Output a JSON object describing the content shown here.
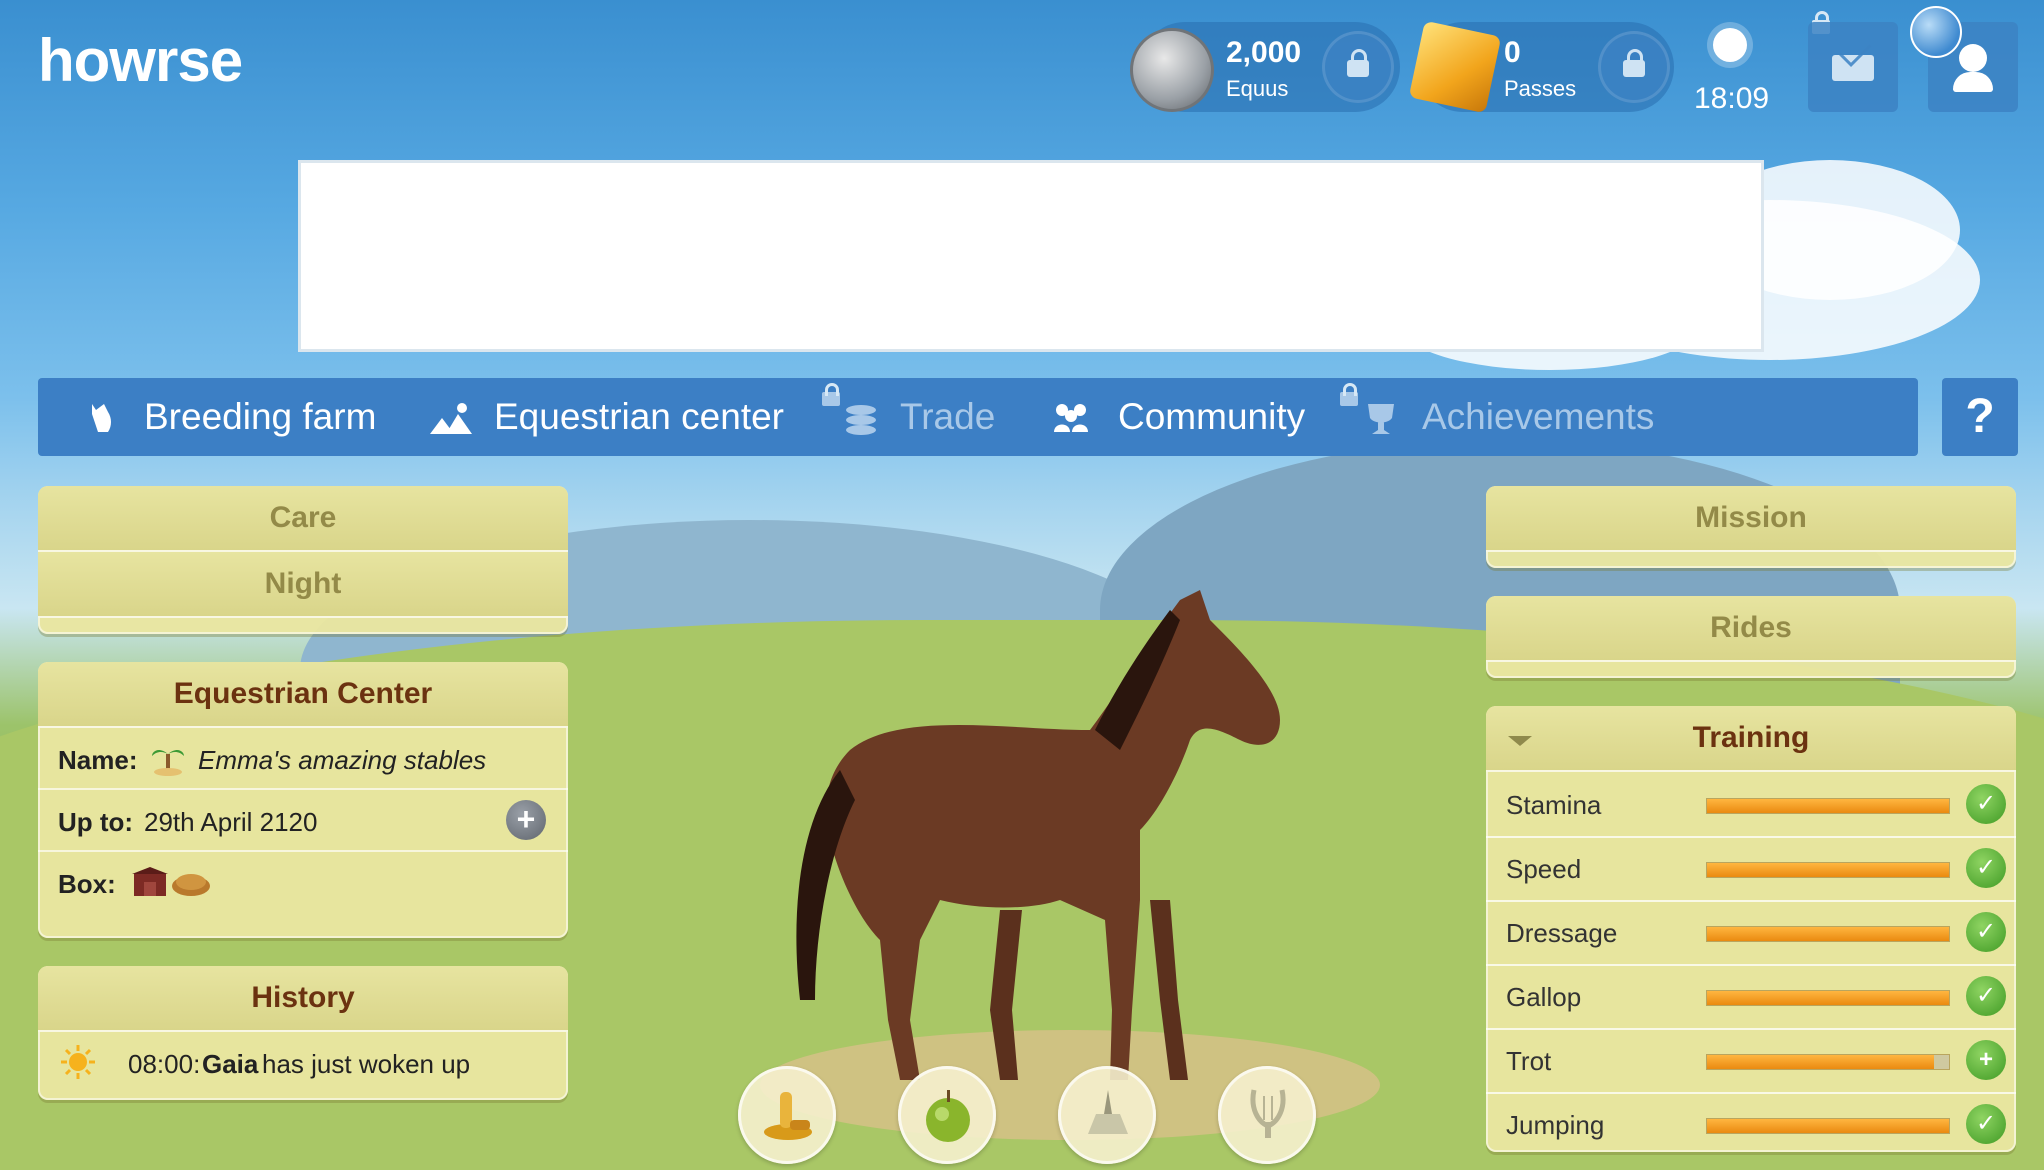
{
  "header": {
    "logo": "howrse",
    "equus_value": "2,000",
    "equus_label": "Equus",
    "passes_value": "0",
    "passes_label": "Passes",
    "time": "18:09"
  },
  "nav": {
    "items": [
      {
        "label": "Breeding farm",
        "icon": "horse-head-icon",
        "enabled": true
      },
      {
        "label": "Equestrian center",
        "icon": "stable-icon",
        "enabled": true
      },
      {
        "label": "Trade",
        "icon": "coins-icon",
        "enabled": false
      },
      {
        "label": "Community",
        "icon": "people-icon",
        "enabled": true
      },
      {
        "label": "Achievements",
        "icon": "trophy-icon",
        "enabled": false
      }
    ],
    "help": "?"
  },
  "left": {
    "care_label": "Care",
    "night_label": "Night",
    "ec_title": "Equestrian Center",
    "name_label": "Name:",
    "name_value": "Emma's amazing stables",
    "upto_label": "Up to:",
    "upto_value": "29th April 2120",
    "box_label": "Box:",
    "history_title": "History",
    "history_time": "08:00:",
    "history_name": "Gaia",
    "history_text": "has just woken up"
  },
  "right": {
    "mission_label": "Mission",
    "rides_label": "Rides",
    "training_title": "Training",
    "training": [
      {
        "name": "Stamina",
        "level": 1.0,
        "status": "done"
      },
      {
        "name": "Speed",
        "level": 1.0,
        "status": "done"
      },
      {
        "name": "Dressage",
        "level": 1.0,
        "status": "done"
      },
      {
        "name": "Gallop",
        "level": 1.0,
        "status": "done"
      },
      {
        "name": "Trot",
        "level": 0.94,
        "status": "plus"
      },
      {
        "name": "Jumping",
        "level": 1.0,
        "status": "done"
      }
    ]
  },
  "actions": [
    "groom-icon",
    "apple-icon",
    "carrot-icon",
    "lyre-icon"
  ],
  "colors": {
    "nav_bg": "#3c7fc5",
    "panel_bg": "#e9e6a0",
    "title_dark": "#6b3210",
    "bar_orange": "#f29e20",
    "check_green": "#4da82d"
  }
}
